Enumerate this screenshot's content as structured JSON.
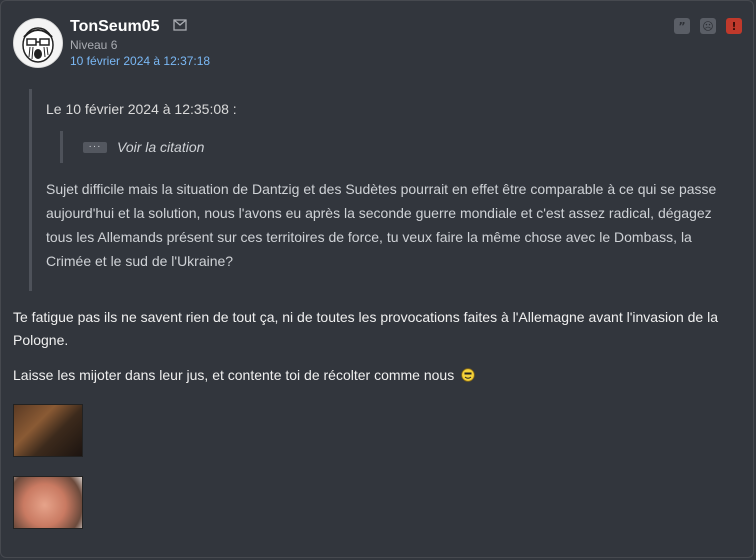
{
  "author": {
    "username": "TonSeum05",
    "level": "Niveau 6",
    "date": "10 février 2024 à 12:37:18",
    "icons": {
      "message": "envelope-icon",
      "avatar": "avatar-image"
    }
  },
  "actions": [
    {
      "icon": "quote-icon",
      "glyph": "”"
    },
    {
      "icon": "ignore-icon",
      "glyph": "☹"
    },
    {
      "icon": "report-icon",
      "glyph": "!"
    }
  ],
  "quote": {
    "header": "Le 10 février 2024 à 12:35:08 :",
    "nested_dots": "···",
    "nested_label": "Voir la citation",
    "text": "Sujet difficile mais la situation de Dantzig et des Sudètes pourrait en effet être comparable à ce qui se passe aujourd'hui et la solution, nous l'avons eu après la seconde guerre mondiale et c'est assez radical, dégagez tous les Allemands présent sur ces territoires de force, tu veux faire la même chose avec le Dombass, la Crimée et le sud de l'Ukraine?"
  },
  "body": {
    "paragraph1": "Te fatigue pas ils ne savent rien de tout ça, ni de toutes les provocations faites à l'Allemagne avant l'invasion de la Pologne.",
    "paragraph2": "Laisse les mijoter dans leur jus, et contente toi de récolter comme nous",
    "smiley": "smiley-icon",
    "images": [
      "sticker-image-1",
      "sticker-image-2"
    ]
  },
  "colors": {
    "background": "#32363d",
    "date_link": "#7ab8f5",
    "report": "#c0392b"
  }
}
